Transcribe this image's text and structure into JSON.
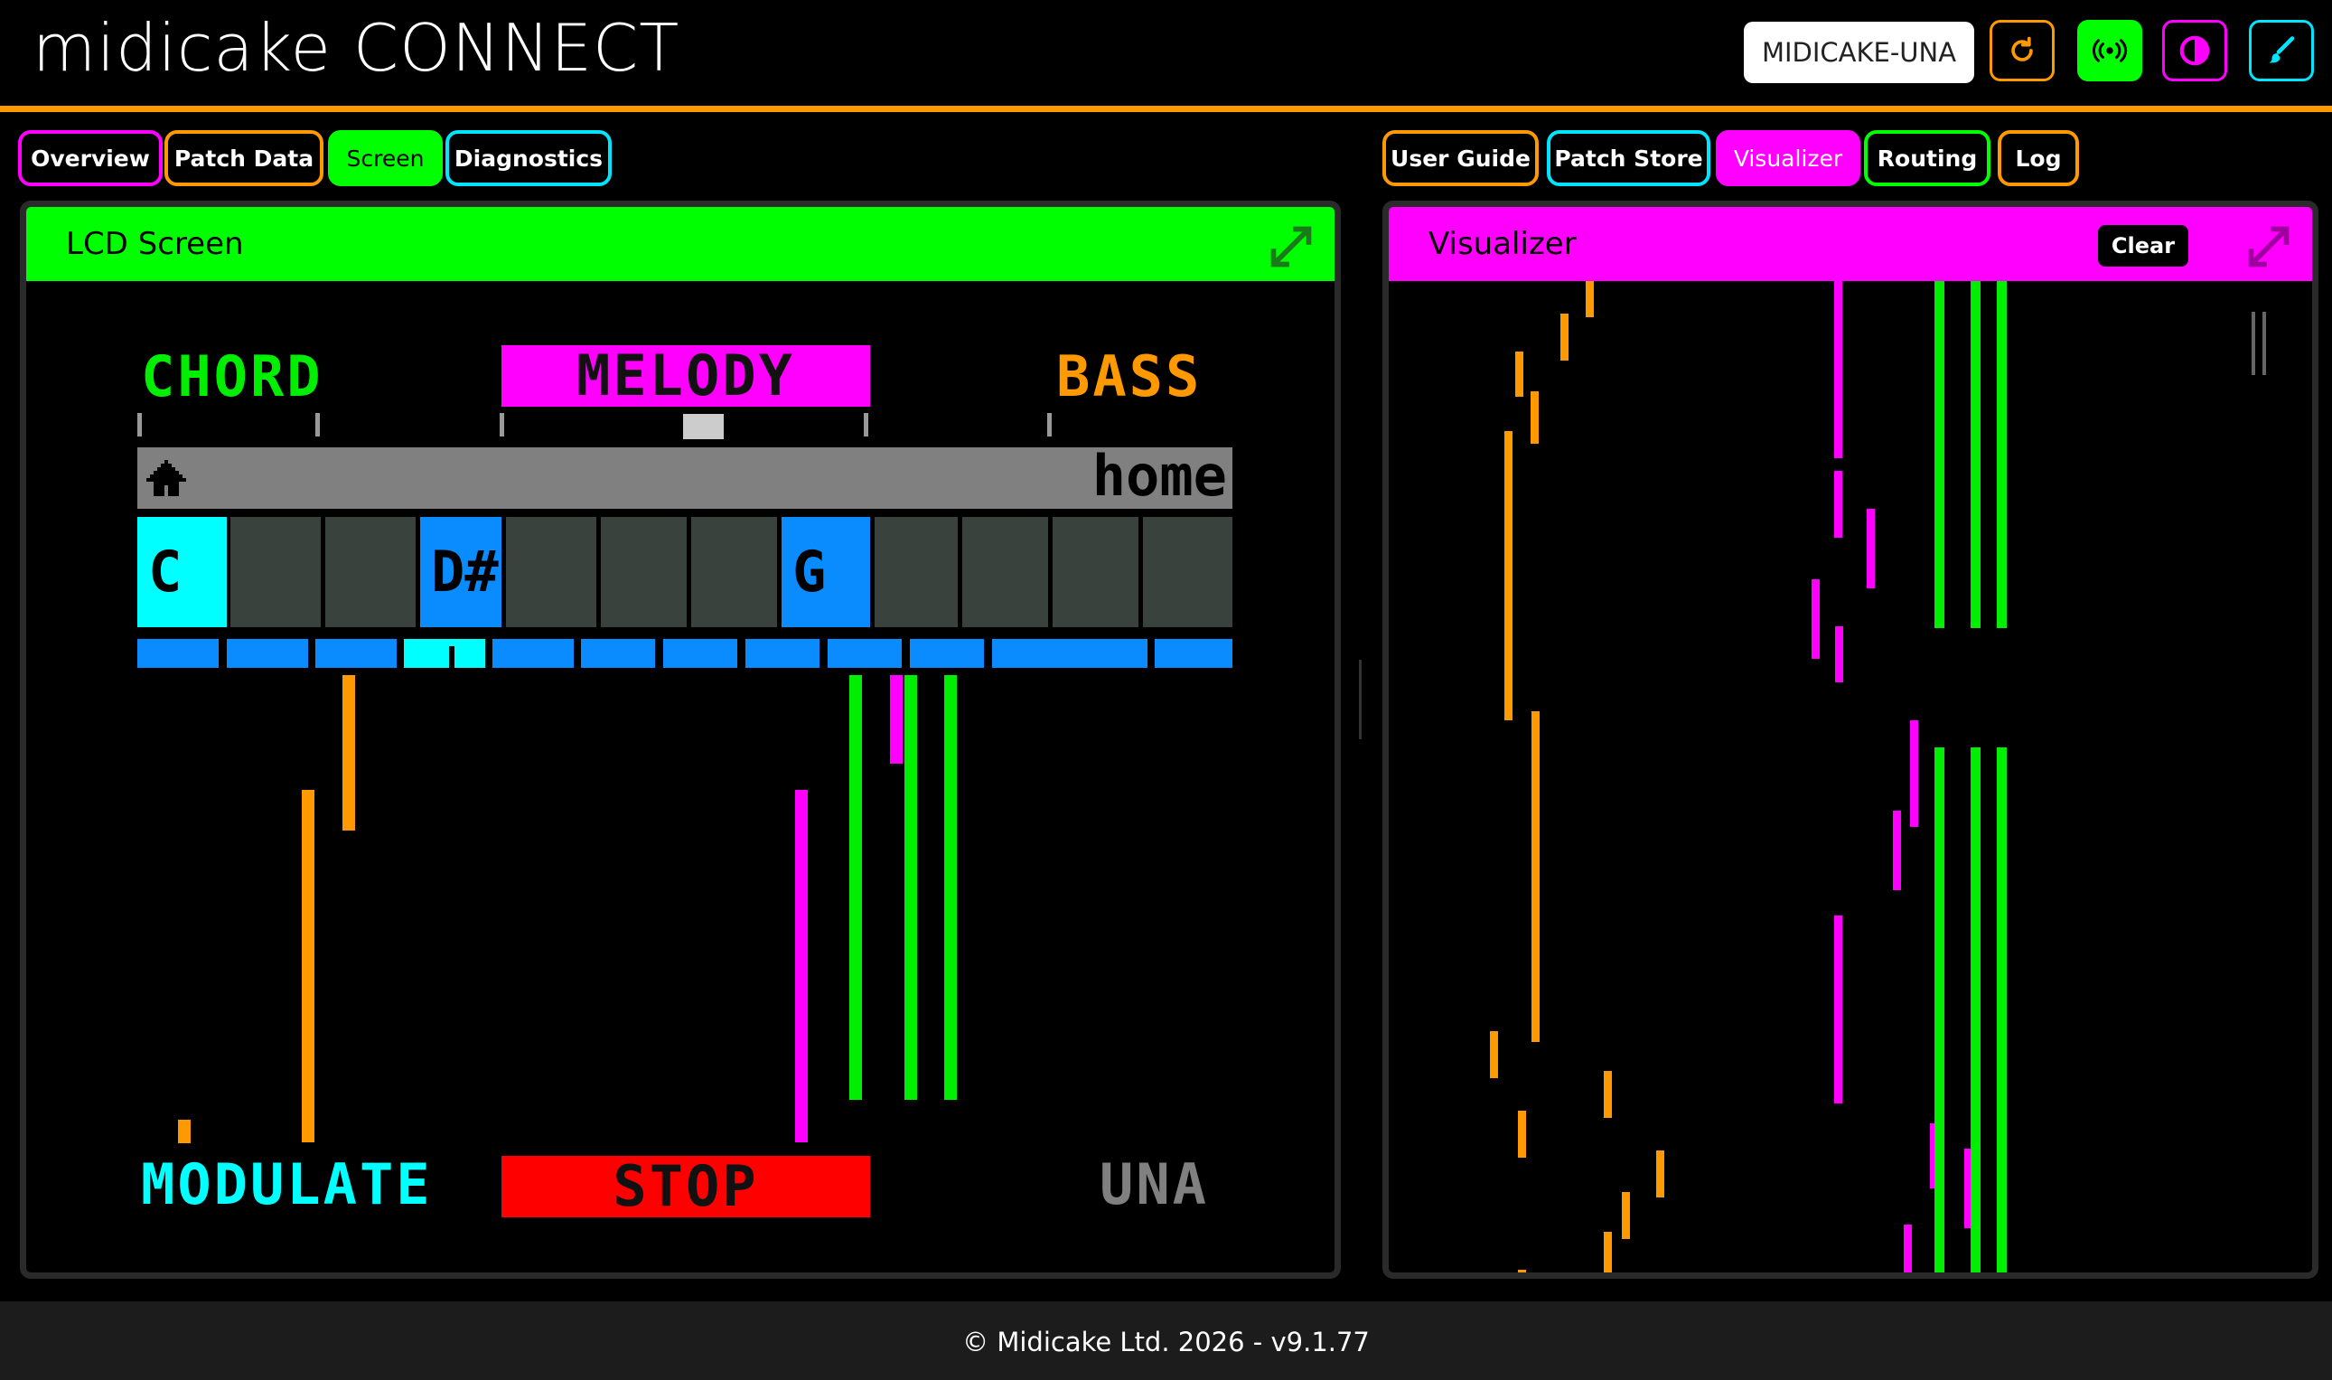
{
  "header": {
    "title": "midicake CONNECT",
    "device_name": "MIDICAKE-UNA",
    "buttons": [
      {
        "name": "refresh-button",
        "icon": "refresh-icon",
        "color": "#ff9900"
      },
      {
        "name": "connection-button",
        "icon": "broadcast-icon",
        "color": "#00ff00"
      },
      {
        "name": "theme-toggle-button",
        "icon": "contrast-icon",
        "color": "#ff00ff"
      },
      {
        "name": "customize-button",
        "icon": "brush-icon",
        "color": "#00e5ff"
      }
    ]
  },
  "left_tabs": [
    {
      "label": "Overview",
      "color": "#ff00ff",
      "active": false
    },
    {
      "label": "Patch Data",
      "color": "#ff9900",
      "active": false
    },
    {
      "label": "Screen",
      "color": "#00ff00",
      "active": true
    },
    {
      "label": "Diagnostics",
      "color": "#00e5ff",
      "active": false
    }
  ],
  "right_tabs": [
    {
      "label": "User Guide",
      "color": "#ff9900",
      "active": false
    },
    {
      "label": "Patch Store",
      "color": "#00e5ff",
      "active": false
    },
    {
      "label": "Visualizer",
      "color": "#ff00ff",
      "active": true
    },
    {
      "label": "Routing",
      "color": "#00ff00",
      "active": false
    },
    {
      "label": "Log",
      "color": "#ff9900",
      "active": false
    }
  ],
  "lcd_panel": {
    "title": "LCD Screen",
    "accent": "#00ff00",
    "screen": {
      "mode_chord": "CHORD",
      "mode_melody": "MELODY",
      "mode_bass": "BASS",
      "menu_label": "home",
      "home_icon": "house-icon",
      "keys": [
        "C",
        "",
        "",
        "D#",
        "",
        "",
        "",
        "G",
        "",
        "",
        "",
        ""
      ],
      "modulate": "MODULATE",
      "stop": "STOP",
      "preset": "UNA",
      "colors": {
        "chord": "#00ee00",
        "melody_bg": "#ff00ff",
        "bass": "#ff9900",
        "modulate": "#00ffff",
        "stop_bg": "#ff0000",
        "preset": "#808080",
        "key_active": "#00ffff",
        "key_held": "#0a8cff",
        "key_idle": "#3a423e"
      }
    }
  },
  "visualizer_panel": {
    "title": "Visualizer",
    "clear_label": "Clear",
    "pause_label": "||",
    "accent": "#ff00ff"
  },
  "footer": {
    "text": "© Midicake Ltd. 2026 - v9.1.77"
  }
}
